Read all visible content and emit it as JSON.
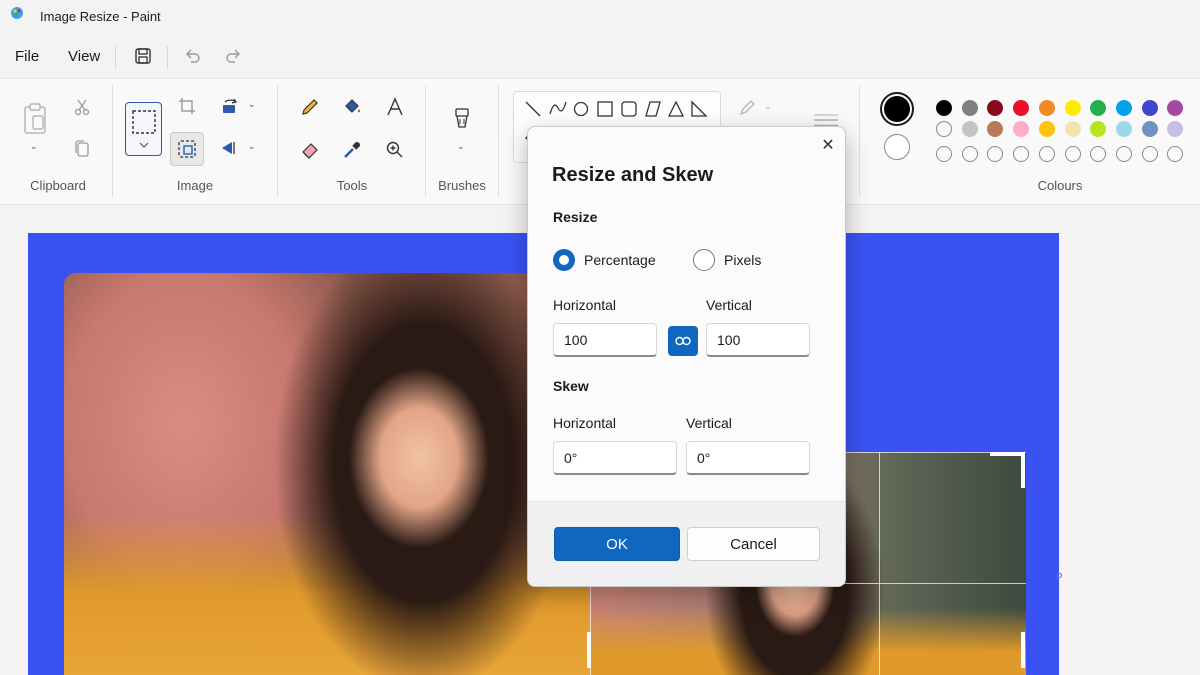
{
  "window": {
    "title": "Image Resize - Paint",
    "app_icon": "paint-icon"
  },
  "menu": {
    "items": [
      "File",
      "View"
    ],
    "icons": [
      "save-icon",
      "undo-icon",
      "redo-icon"
    ]
  },
  "ribbon": {
    "groups": {
      "clipboard": "Clipboard",
      "image": "Image",
      "tools": "Tools",
      "brushes": "Brushes",
      "colours": "Colours"
    }
  },
  "colors": {
    "accent": "#0f67c0",
    "canvas": "#3a52f3",
    "primary_color": "#000000",
    "secondary_color": "#ffffff",
    "palette_row1": [
      "#000000",
      "#808080",
      "#8b0a1a",
      "#e8102a",
      "#f08a24",
      "#ffeb00",
      "#22b14c",
      "#00a2e8",
      "#3f48cc",
      "#a349a4"
    ],
    "palette_row2": [
      "#ffffff",
      "#c3c3c3",
      "#b97a57",
      "#ffaec9",
      "#ffc20e",
      "#efe4b0",
      "#b5e61d",
      "#99d9ea",
      "#7092be",
      "#c8bfe7"
    ]
  },
  "dialog": {
    "title": "Resize and Skew",
    "resize_section": "Resize",
    "option_percentage": "Percentage",
    "option_pixels": "Pixels",
    "selected_option": "Percentage",
    "resize_horizontal_label": "Horizontal",
    "resize_vertical_label": "Vertical",
    "resize_horizontal_value": "100",
    "resize_vertical_value": "100",
    "skew_section": "Skew",
    "skew_horizontal_label": "Horizontal",
    "skew_vertical_label": "Vertical",
    "skew_horizontal_value": "0°",
    "skew_vertical_value": "0°",
    "ok_label": "OK",
    "cancel_label": "Cancel"
  }
}
